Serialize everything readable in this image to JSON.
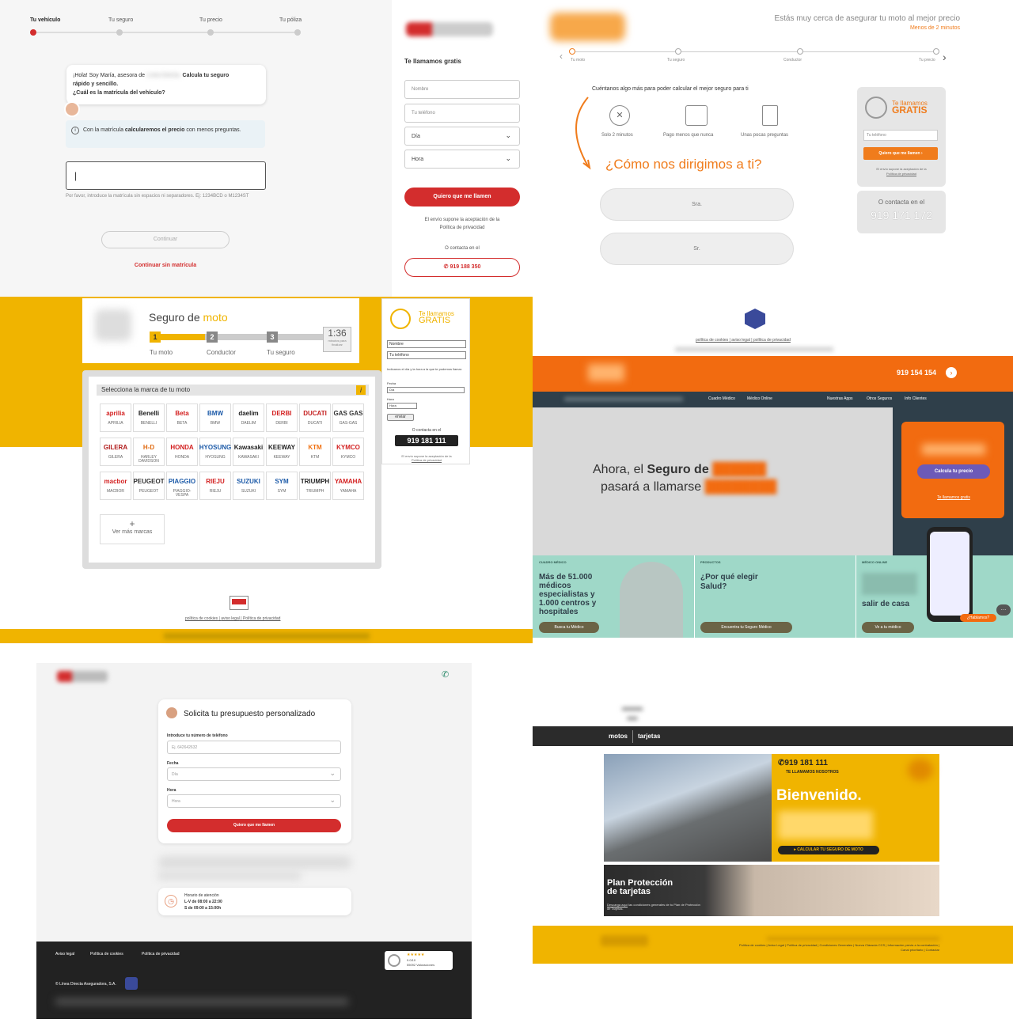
{
  "panel1": {
    "steps": [
      "Tu vehículo",
      "Tu seguro",
      "Tu precio",
      "Tu póliza"
    ],
    "chat": {
      "greeting": "¡Hola! Soy María, asesora de",
      "brand_blurred": "Línea Directa.",
      "bold1": "Calcula tu seguro",
      "line2": "rápido y sencillo.",
      "question": "¿Cuál es la matrícula del vehículo?"
    },
    "info": {
      "pre": "Con la matrícula ",
      "bold": "calcularemos el precio",
      "post": " con menos preguntas."
    },
    "plate_value": "|",
    "hint": "Por favor, introduce la matrícula sin espacios ni separadores. Ej: 1234BCD o M1234ST",
    "continue_label": "Continuar",
    "no_plate_label": "Continuar sin matrícula"
  },
  "panel2": {
    "title": "Te llamamos gratis",
    "name_placeholder": "Nombre",
    "phone_placeholder": "Tu teléfono",
    "day_label": "Día",
    "hour_label": "Hora",
    "submit_label": "Quiero que me llamen",
    "legal1": "El envío supone la aceptación de la",
    "legal2": "Política de privacidad",
    "contact_label": "O contacta en el",
    "phone": "919 188 350"
  },
  "panel3": {
    "headline": "Estás muy cerca de asegurar tu moto al mejor precio",
    "subhead": "Menos de 2 minutos",
    "steps": [
      "Tu moto",
      "Tu seguro",
      "Conductor",
      "Tu precio"
    ],
    "intro": "Cuéntanos algo más para poder calcular el mejor seguro para ti",
    "features": [
      "Solo 2 minutos",
      "Pago menos que nunca",
      "Unas pocas preguntas"
    ],
    "question": "¿Cómo nos dirigimos a ti?",
    "opt1": "Sra.",
    "opt2": "Sr.",
    "callback_title1": "Te llamamos",
    "callback_title2": "GRATIS",
    "callback_phone_placeholder": "Tu teléfono",
    "callback_button": "Quiero que me llamen ›",
    "callback_legal1": "El envío supone la aceptación de la",
    "callback_legal2": "Política de privacidad",
    "contact_label": "O contacta en el",
    "phone": "919 171 172"
  },
  "panel4": {
    "title_pre": "Seguro de ",
    "title_accent": "moto",
    "steps": [
      {
        "num": "1",
        "label": "Tu moto"
      },
      {
        "num": "2",
        "label": "Conductor"
      },
      {
        "num": "3",
        "label": "Tu seguro"
      }
    ],
    "timer": "1:36",
    "timer_caption": "minutos para finalizar",
    "brand_header": "Selecciona la marca de tu moto",
    "brands": [
      {
        "logo": "aprilia",
        "name": "APRILIA",
        "color": "#d32020"
      },
      {
        "logo": "Benelli",
        "name": "BENELLI",
        "color": "#222222"
      },
      {
        "logo": "Beta",
        "name": "BETA",
        "color": "#d32020"
      },
      {
        "logo": "BMW",
        "name": "BMW",
        "color": "#1c5aa8"
      },
      {
        "logo": "daelim",
        "name": "DAELIM",
        "color": "#222222"
      },
      {
        "logo": "DERBI",
        "name": "DERBI",
        "color": "#d32020"
      },
      {
        "logo": "DUCATI",
        "name": "DUCATI",
        "color": "#c41e1e"
      },
      {
        "logo": "GAS GAS",
        "name": "GAS-GAS",
        "color": "#333333"
      },
      {
        "logo": "GILERA",
        "name": "GILERA",
        "color": "#b01818"
      },
      {
        "logo": "H-D",
        "name": "HARLEY DAVIDSON",
        "color": "#e06a10"
      },
      {
        "logo": "HONDA",
        "name": "HONDA",
        "color": "#d32020"
      },
      {
        "logo": "HYOSUNG",
        "name": "HYOSUNG",
        "color": "#1c5aa8"
      },
      {
        "logo": "Kawasaki",
        "name": "KAWASAKI",
        "color": "#222222"
      },
      {
        "logo": "KEEWAY",
        "name": "KEEWAY",
        "color": "#222222"
      },
      {
        "logo": "KTM",
        "name": "KTM",
        "color": "#f07010"
      },
      {
        "logo": "KYMCO",
        "name": "KYMCO",
        "color": "#d32020"
      },
      {
        "logo": "macbor",
        "name": "MACBOR",
        "color": "#d32020"
      },
      {
        "logo": "PEUGEOT",
        "name": "PEUGEOT",
        "color": "#333333"
      },
      {
        "logo": "PIAGGIO",
        "name": "PIAGGIO-VESPA",
        "color": "#1c5aa8"
      },
      {
        "logo": "RIEJU",
        "name": "RIEJU",
        "color": "#d32020"
      },
      {
        "logo": "SUZUKI",
        "name": "SUZUKI",
        "color": "#1c5aa8"
      },
      {
        "logo": "SYM",
        "name": "SYM",
        "color": "#1c5aa8"
      },
      {
        "logo": "TRIUMPH",
        "name": "TRIUMPH",
        "color": "#222222"
      },
      {
        "logo": "YAMAHA",
        "name": "YAMAHA",
        "color": "#d32020"
      }
    ],
    "more_brands": "Ver más marcas",
    "callback_title1": "Te llamamos",
    "callback_title2": "GRATIS",
    "name_placeholder": "Nombre",
    "phone_placeholder": "Tu teléfono",
    "callback_intro": "Indícanos el día y la hora a la que te podemos llamar.",
    "date_label": "Fecha",
    "date_value": "Día",
    "hour_label": "Hora",
    "hour_value": "Hora",
    "send_label": "enviar",
    "contact_label": "O contacta en el",
    "phone": "919 181 111",
    "legal1": "El envío supone la aceptación de la",
    "legal2": "Política de privacidad",
    "footer_links": [
      "política de cookies",
      "aviso legal",
      "Política de privacidad"
    ]
  },
  "panel5": {
    "footer_links": [
      "política de cookies",
      "aviso legal",
      "política de privacidad"
    ],
    "phone": "919 154 154",
    "nav": [
      "Cuadro Médico",
      "Médico Online",
      "Nuestras Apps",
      "Otros Seguros",
      "Info Clientes"
    ],
    "hero_line1_pre": "Ahora, el ",
    "hero_line1_bold": "Seguro de",
    "hero_line2": "pasará a llamarse",
    "cta_button": "Calcula tu precio",
    "cta_link": "Te llamamos gratis",
    "cards": [
      {
        "kicker": "CUADRO MÉDICO",
        "title": "Más de 51.000 médicos especialistas y 1.000 centros y hospitales",
        "button": "Busca tu Médico"
      },
      {
        "kicker": "PRODUCTOS",
        "title": "¿Por qué elegir",
        "title2": "Salud?",
        "button": "Encuentra tu Seguro Médico"
      },
      {
        "kicker": "MÉDICO ONLINE",
        "title": "salir de casa",
        "button": "Ve a tu médico"
      }
    ],
    "chat_bubble": "¿Hablamos?"
  },
  "panel6": {
    "title": "Solicita tu presupuesto personalizado",
    "phone_label": "Introduce tu número de teléfono",
    "phone_placeholder": "Ej. 642642632",
    "date_label": "Fecha",
    "date_value": "Día",
    "hour_label": "Hora",
    "hour_value": "Hora",
    "submit": "Quiero que me llamen",
    "hours_title": "Horario de atención",
    "hours1": "L-V de 08:00 a 22:00",
    "hours2": "S de 09:00 a 15:00h",
    "footer_links": [
      "Aviso legal",
      "Política de cookies",
      "Política de privacidad"
    ],
    "copyright": "© Línea Directa Aseguradora, S.A.",
    "rating_stars": "★★★★★",
    "rating_score": "9.0/10",
    "rating_count": "55092 Valoraciones"
  },
  "panel7": {
    "tabs": [
      "motos",
      "tarjetas"
    ],
    "phone": "919 181 111",
    "phone_caption": "TE LLAMAMOS NOSOTROS",
    "welcome": "Bienvenido.",
    "cta": "CALCULAR TU SEGURO DE MOTO",
    "plan_title1": "Plan Protección",
    "plan_title2": "de tarjetas",
    "plan_desc_link": "Descarga aquí",
    "plan_desc": " las condiciones generales de tu Plan de Protección de Tarjetas.",
    "footer_links": [
      "Política de cookies",
      "Aviso Legal",
      "Política de privacidad",
      "Condiciones Generales",
      "Nueva Cláusula CCS",
      "Información previa a la contratación",
      "Canal prioritario",
      "Contactar"
    ]
  },
  "colors": {
    "red": "#d32d2d",
    "orange": "#f07c1c",
    "yellow": "#f0b400",
    "dark": "#222222",
    "teal": "#9fd8c8",
    "purple": "#6c5ab8"
  }
}
